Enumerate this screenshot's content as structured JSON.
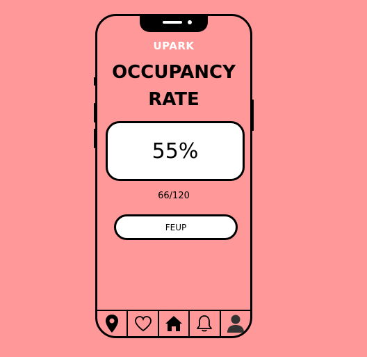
{
  "app": {
    "brand": "UPARK"
  },
  "header": {
    "title_line1": "OCCUPANCY",
    "title_line2": "RATE"
  },
  "occupancy": {
    "rate_text": "55%",
    "rate_value": 55,
    "occupied": 66,
    "capacity": 120,
    "count_text": "66/120"
  },
  "location": {
    "selected": "FEUP"
  },
  "nav": {
    "items": [
      {
        "icon": "map-pin-icon"
      },
      {
        "icon": "heart-icon"
      },
      {
        "icon": "home-icon",
        "active": true
      },
      {
        "icon": "bell-icon"
      },
      {
        "icon": "user-icon"
      }
    ]
  },
  "colors": {
    "background": "#ff9999",
    "accent_text": "#ffffff",
    "ink": "#000000"
  }
}
